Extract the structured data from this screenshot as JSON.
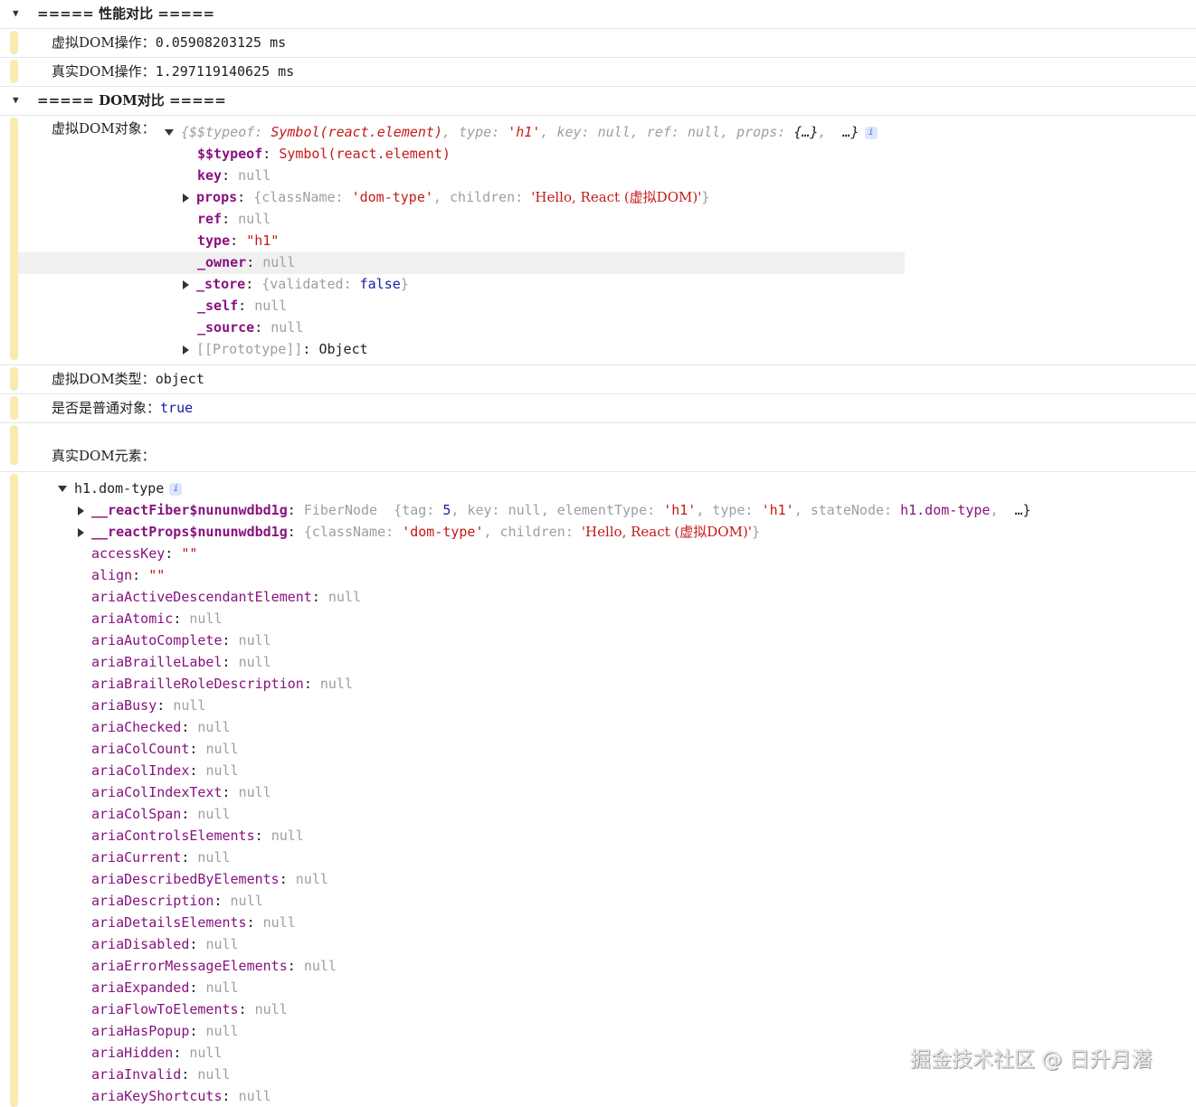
{
  "groups": {
    "perf": {
      "title": "===== 性能对比 ====="
    },
    "dom": {
      "title": "===== DOM对比 ====="
    }
  },
  "perf_msgs": [
    {
      "label": "虚拟DOM操作：",
      "value": "0.05908203125 ms"
    },
    {
      "label": "真实DOM操作：",
      "value": "1.297119140625 ms"
    }
  ],
  "vdom": {
    "label": "虚拟DOM对象：",
    "summary": {
      "open": "{",
      "k1": "$$typeof",
      "v1": "Symbol(react.element)",
      "k2": "type",
      "v2": "'h1'",
      "k3": "key",
      "v3": "null",
      "k4": "ref",
      "v4": "null",
      "k5": "props",
      "v5": "{…}",
      "more": "…}",
      "info": "i"
    },
    "props": [
      {
        "key": "$$typeof",
        "value": "Symbol(react.element)",
        "kind": "sym",
        "arrow": false
      },
      {
        "key": "key",
        "value": "null",
        "kind": "null",
        "arrow": false
      },
      {
        "key": "props",
        "value": "",
        "kind": "props",
        "arrow": true
      },
      {
        "key": "ref",
        "value": "null",
        "kind": "null",
        "arrow": false
      },
      {
        "key": "type",
        "value": "\"h1\"",
        "kind": "str",
        "arrow": false
      },
      {
        "key": "_owner",
        "value": "null",
        "kind": "null",
        "arrow": false
      },
      {
        "key": "_store",
        "value": "",
        "kind": "store",
        "arrow": true
      },
      {
        "key": "_self",
        "value": "null",
        "kind": "null",
        "arrow": false
      },
      {
        "key": "_source",
        "value": "null",
        "kind": "null",
        "arrow": false
      },
      {
        "key": "[[Prototype]]",
        "value": "Object",
        "kind": "proto",
        "arrow": true
      }
    ],
    "props_obj": {
      "open": "{className",
      "cls": "'dom-type'",
      "children_key": "children",
      "children": "'Hello, React (虚拟DOM)'",
      "close": "}"
    },
    "store_obj": {
      "open": "{validated",
      "val": "false",
      "close": "}"
    }
  },
  "vdom_type": {
    "label": "虚拟DOM类型：",
    "value": "object"
  },
  "is_plain": {
    "label": "是否是普通对象：",
    "value": "true"
  },
  "real_dom": {
    "label": "真实DOM元素：",
    "node": "h1.dom-type",
    "info": "i",
    "fiber": {
      "key": "__reactFiber$nununwdbd1g",
      "type": "FiberNode",
      "open": "{tag",
      "tag": "5",
      "k_key": "key",
      "v_key": "null",
      "k_et": "elementType",
      "v_et": "'h1'",
      "k_type": "type",
      "v_type": "'h1'",
      "k_sn": "stateNode",
      "v_sn": "h1.dom-type",
      "more": "…}"
    },
    "propsrow": {
      "key": "__reactProps$nununwdbd1g",
      "open": "{className",
      "cls": "'dom-type'",
      "children_key": "children",
      "children": "'Hello, React (虚拟DOM)'",
      "close": "}"
    },
    "attrs": [
      {
        "key": "accessKey",
        "value": "\"\"",
        "str": true
      },
      {
        "key": "align",
        "value": "\"\"",
        "str": true
      },
      {
        "key": "ariaActiveDescendantElement",
        "value": "null"
      },
      {
        "key": "ariaAtomic",
        "value": "null"
      },
      {
        "key": "ariaAutoComplete",
        "value": "null"
      },
      {
        "key": "ariaBrailleLabel",
        "value": "null"
      },
      {
        "key": "ariaBrailleRoleDescription",
        "value": "null"
      },
      {
        "key": "ariaBusy",
        "value": "null"
      },
      {
        "key": "ariaChecked",
        "value": "null"
      },
      {
        "key": "ariaColCount",
        "value": "null"
      },
      {
        "key": "ariaColIndex",
        "value": "null"
      },
      {
        "key": "ariaColIndexText",
        "value": "null"
      },
      {
        "key": "ariaColSpan",
        "value": "null"
      },
      {
        "key": "ariaControlsElements",
        "value": "null"
      },
      {
        "key": "ariaCurrent",
        "value": "null"
      },
      {
        "key": "ariaDescribedByElements",
        "value": "null"
      },
      {
        "key": "ariaDescription",
        "value": "null"
      },
      {
        "key": "ariaDetailsElements",
        "value": "null"
      },
      {
        "key": "ariaDisabled",
        "value": "null"
      },
      {
        "key": "ariaErrorMessageElements",
        "value": "null"
      },
      {
        "key": "ariaExpanded",
        "value": "null"
      },
      {
        "key": "ariaFlowToElements",
        "value": "null"
      },
      {
        "key": "ariaHasPopup",
        "value": "null"
      },
      {
        "key": "ariaHidden",
        "value": "null"
      },
      {
        "key": "ariaInvalid",
        "value": "null"
      },
      {
        "key": "ariaKeyShortcuts",
        "value": "null"
      }
    ]
  },
  "watermark": "掘金技术社区 @ 日升月潜"
}
